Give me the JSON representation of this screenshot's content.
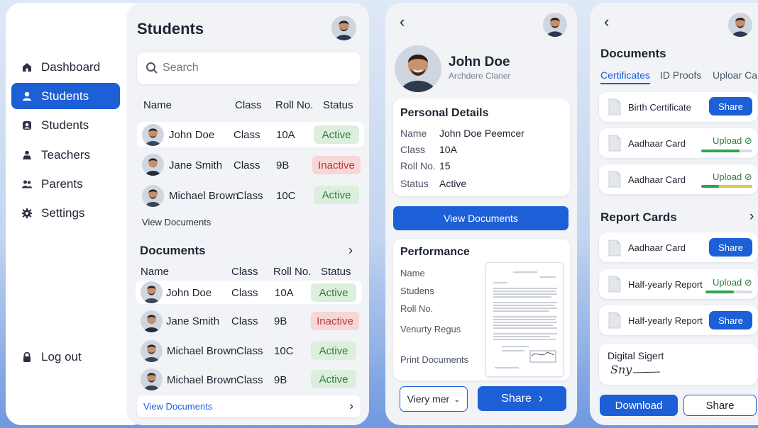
{
  "sidebar": {
    "items": [
      {
        "label": "Dashboard",
        "icon": "home-icon"
      },
      {
        "label": "Students",
        "icon": "student-icon",
        "active": true
      },
      {
        "label": "Students",
        "icon": "student-card-icon"
      },
      {
        "label": "Teachers",
        "icon": "teacher-icon"
      },
      {
        "label": "Parents",
        "icon": "parents-icon"
      },
      {
        "label": "Settings",
        "icon": "gear-icon"
      }
    ],
    "logout_label": "Log out"
  },
  "students_panel": {
    "title": "Students",
    "search_placeholder": "Search",
    "columns": [
      "Name",
      "Class",
      "Roll No.",
      "Status"
    ],
    "rows": [
      {
        "name": "John Doe",
        "class": "Class",
        "roll": "10A",
        "status": "Active"
      },
      {
        "name": "Jane Smith",
        "class": "Class",
        "roll": "9B",
        "status": "Inactive"
      },
      {
        "name": "Michael Brown",
        "class": "Class",
        "roll": "10C",
        "status": "Active"
      }
    ],
    "view_documents": "View Documents",
    "documents_title": "Documents",
    "doc_columns": [
      "Name",
      "Class",
      "Roll No.",
      "Status"
    ],
    "doc_rows": [
      {
        "name": "John Doe",
        "class": "Class",
        "roll": "10A",
        "status": "Active"
      },
      {
        "name": "Jane Smith",
        "class": "Class",
        "roll": "9B",
        "status": "Inactive"
      },
      {
        "name": "Michael Brown",
        "class": "Class",
        "roll": "10C",
        "status": "Active"
      },
      {
        "name": "Michael Brown",
        "class": "Class",
        "roll": "9B",
        "status": "Active"
      }
    ],
    "view_documents_link": "View Documents"
  },
  "profile_panel": {
    "name": "John Doe",
    "subtitle": "Archdere Claner",
    "personal_title": "Personal Details",
    "details": [
      {
        "label": "Name",
        "value": "John Doe   Peemcer"
      },
      {
        "label": "Class",
        "value": "10A"
      },
      {
        "label": "Roll No.",
        "value": "15"
      },
      {
        "label": "Status",
        "value": "Active"
      }
    ],
    "view_documents_button": "View Documents",
    "performance_title": "Performance",
    "performance_items": [
      "Name",
      "Studens",
      "Roll No.",
      "Venurty Regus",
      "Print Documents"
    ],
    "select_value": "Viery mer",
    "share_button": "Share"
  },
  "documents_panel": {
    "title": "Documents",
    "tabs": [
      "Certificates",
      "ID Proofs",
      "Uploar Ca"
    ],
    "certificates": [
      {
        "name": "Birth Certificate",
        "action": "Share"
      },
      {
        "name": "Aadhaar Card",
        "action": "Upload",
        "progress": 0.75
      },
      {
        "name": "Aadhaar Card",
        "action": "Upload",
        "progress": 0.35
      }
    ],
    "report_title": "Report Cards",
    "reports": [
      {
        "name": "Aadhaar Card",
        "action": "Share"
      },
      {
        "name": "Half-yearly Report",
        "action": "Upload",
        "progress": 0.6
      },
      {
        "name": "Half-yearly Report",
        "action": "Share"
      }
    ],
    "signature_title": "Digital Sigert",
    "signature_text": "Sny",
    "download_button": "Download",
    "share_button": "Share"
  },
  "colors": {
    "accent": "#1d5fd6",
    "active_bg": "#dcefdc",
    "inactive_bg": "#f7d6d6",
    "progress_green": "#2fa44f",
    "progress_yellow": "#e2c84a"
  }
}
